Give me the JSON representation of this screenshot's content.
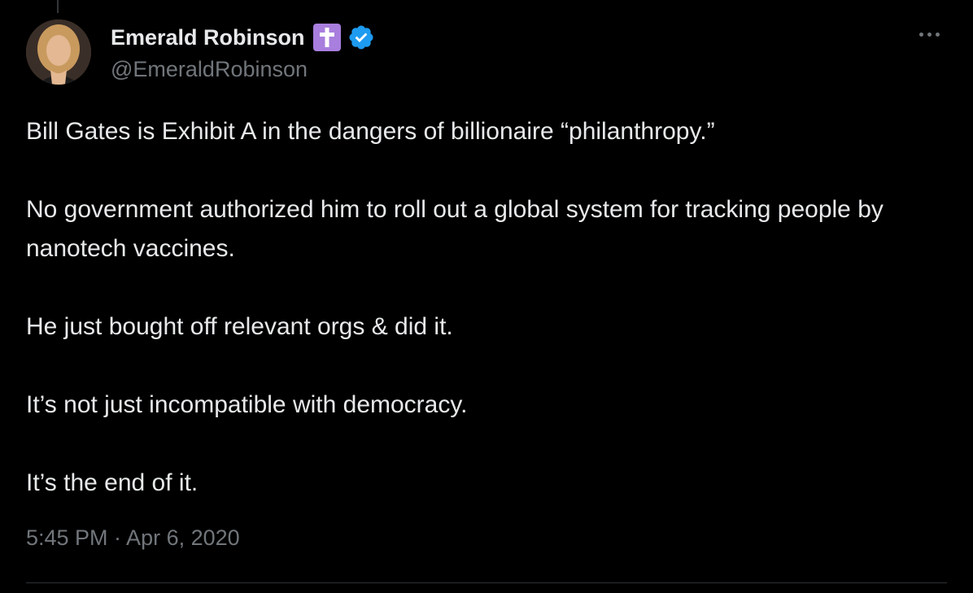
{
  "author": {
    "display_name": "Emerald Robinson",
    "handle": "@EmeraldRobinson",
    "badges": [
      "cross-emoji-icon",
      "verified-badge-icon"
    ]
  },
  "tweet": {
    "paragraphs": [
      "Bill Gates is Exhibit A in the dangers of billionaire “philanthropy.”",
      "No government authorized him to roll out a global system for tracking people by nanotech vaccines.",
      "He just bought off relevant orgs & did it.",
      "It’s not just incompatible with democracy.",
      "It’s the end of it."
    ],
    "timestamp": "5:45 PM · Apr 6, 2020"
  },
  "colors": {
    "background": "#000000",
    "text": "#e7e9ea",
    "secondary_text": "#71767b",
    "verified_blue": "#1d9bf0",
    "cross_badge": "#a87ede",
    "divider": "#2f3336"
  },
  "icons": {
    "more": "more-options-icon"
  }
}
